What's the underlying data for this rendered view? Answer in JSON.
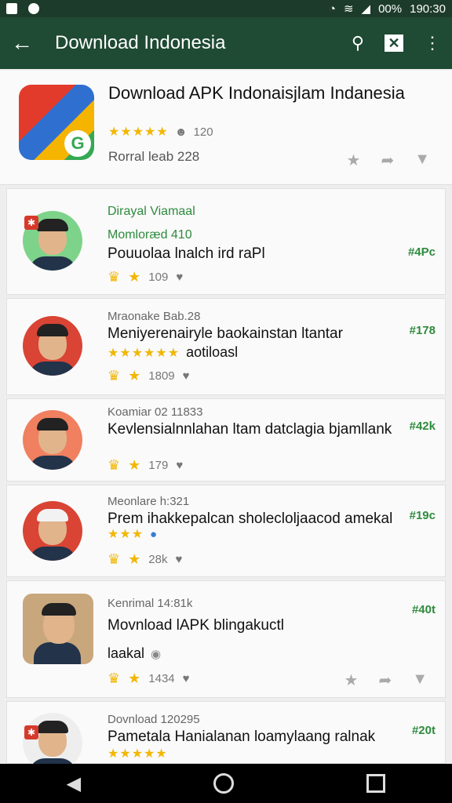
{
  "status": {
    "battery": "00%",
    "time": "190:30"
  },
  "appbar": {
    "title": "Download Indonesia",
    "back_icon": "arrow-left-icon",
    "search_icon": "search-icon",
    "close_icon": "close-box-icon",
    "menu_icon": "more-vert-icon"
  },
  "header": {
    "title": "Download APK Indonaisjlam Indanesia",
    "stars": "★★★★★",
    "rating_count": "120",
    "sub": "Rorral leab 228"
  },
  "list": [
    {
      "line1": "Dirayal Viamaal",
      "line1b": "Momloræd 410",
      "line2": "Pouuolaa lnalch ird raPl",
      "meta": "109",
      "price": "#4Pc"
    },
    {
      "line1": "Mraonake Bab.28",
      "line2": "Meniyerenairyle baokainstan ltantar",
      "line3": "aotiloasl",
      "stars": "★★★★★★",
      "meta": "1809",
      "price": "#178"
    },
    {
      "line1": "Koamiar 02 11833",
      "line2": "Kevlensialnnlahan ltam datclagia bjamllank",
      "meta": "179",
      "price": "#42k"
    },
    {
      "line1": "Meonlare h:321",
      "line2": "Prem ihakkepalcan sholecloljaacod amekal",
      "stars": "★★★",
      "meta": "28k",
      "price": "#19c"
    },
    {
      "line1": "Kenrimal 14:81k",
      "line2": "Movnload lAPK blingakuctl",
      "line3": "laakal",
      "meta": "1434",
      "price": "#40t"
    },
    {
      "line1": "Dovnload 120295",
      "line2": "Pametala Hanialanan loamylaang ralnak",
      "stars": "★★★★★",
      "price": "#20t"
    }
  ]
}
